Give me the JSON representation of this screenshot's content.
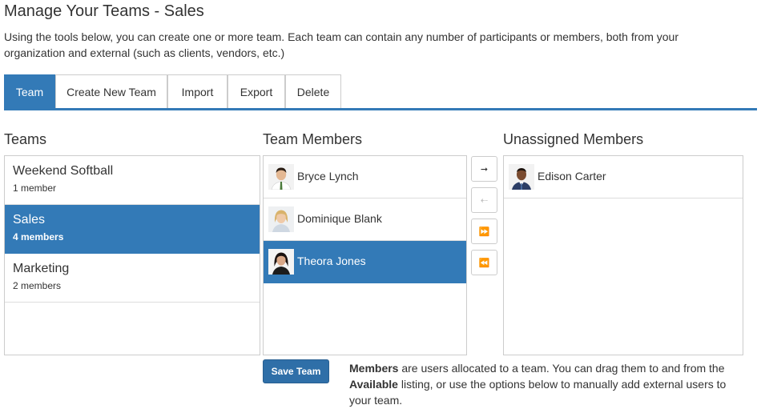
{
  "page": {
    "title": "Manage Your Teams - Sales",
    "description": "Using the tools below, you can create one or more team. Each team can contain any number of participants or members, both from your organization and external (such as clients, vendors, etc.)"
  },
  "tabs": [
    {
      "label": "Team",
      "active": true
    },
    {
      "label": "Create New Team",
      "active": false
    },
    {
      "label": "Import",
      "active": false
    },
    {
      "label": "Export",
      "active": false
    },
    {
      "label": "Delete",
      "active": false
    }
  ],
  "teams": {
    "heading": "Teams",
    "items": [
      {
        "name": "Weekend Softball",
        "count": "1 member"
      },
      {
        "name": "Sales",
        "count": "4 members",
        "selected": true
      },
      {
        "name": "Marketing",
        "count": "2 members"
      }
    ]
  },
  "team_members": {
    "heading": "Team Members",
    "items": [
      {
        "name": "Bryce Lynch"
      },
      {
        "name": "Dominique Blank"
      },
      {
        "name": "Theora Jones",
        "selected": true
      }
    ]
  },
  "unassigned": {
    "heading": "Unassigned Members",
    "items": [
      {
        "name": "Edison Carter"
      }
    ]
  },
  "controls": {
    "move_right": "➞",
    "move_left": "⇠",
    "move_all_right": "⏩",
    "move_all_left": "⏪"
  },
  "actions": {
    "save_label": "Save Team"
  },
  "help": {
    "members_term": "Members",
    "text1": " are users allocated to a team. You can drag them to and from the ",
    "available_term": "Available",
    "text2": " listing, or use the options below to manually add external users to your team."
  },
  "colors": {
    "primary": "#337ab7",
    "save_button": "#2f6fa8",
    "border": "#cccccc"
  }
}
